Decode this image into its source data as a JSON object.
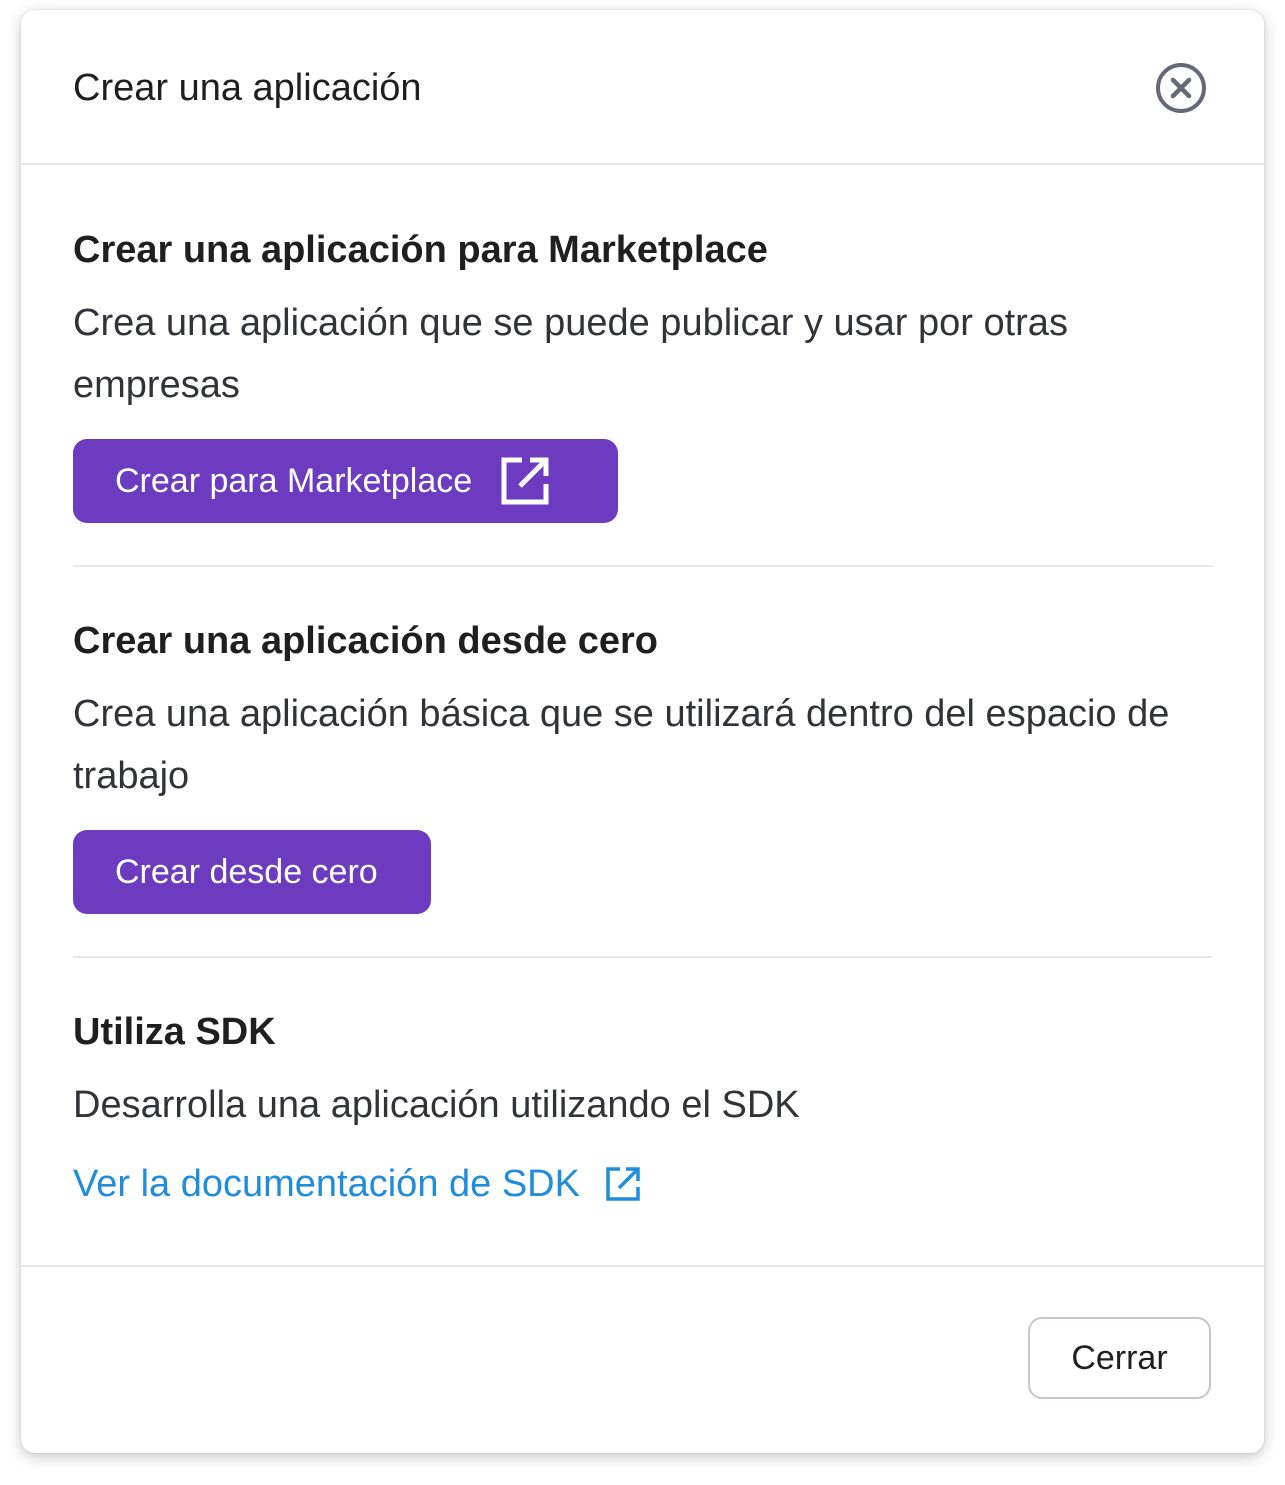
{
  "dialog": {
    "title": "Crear una aplicación",
    "close_icon": "close-circle-icon"
  },
  "sections": [
    {
      "title": "Crear una aplicación para Marketplace",
      "description": "Crea una aplicación que se puede publicar y usar por otras empresas",
      "button_label": "Crear para Marketplace",
      "button_icon": "external-link-icon"
    },
    {
      "title": "Crear una aplicación desde cero",
      "description": "Crea una aplicación básica que se utilizará dentro del espacio de trabajo",
      "button_label": "Crear desde cero"
    },
    {
      "title": "Utiliza SDK",
      "description": "Desarrolla una aplicación utilizando el SDK",
      "link_label": "Ver la documentación de SDK",
      "link_icon": "external-link-icon"
    }
  ],
  "footer": {
    "close_label": "Cerrar"
  },
  "colors": {
    "primary": "#6c3bbf",
    "link": "#1f8ddb",
    "divider": "#e6e7eb"
  }
}
